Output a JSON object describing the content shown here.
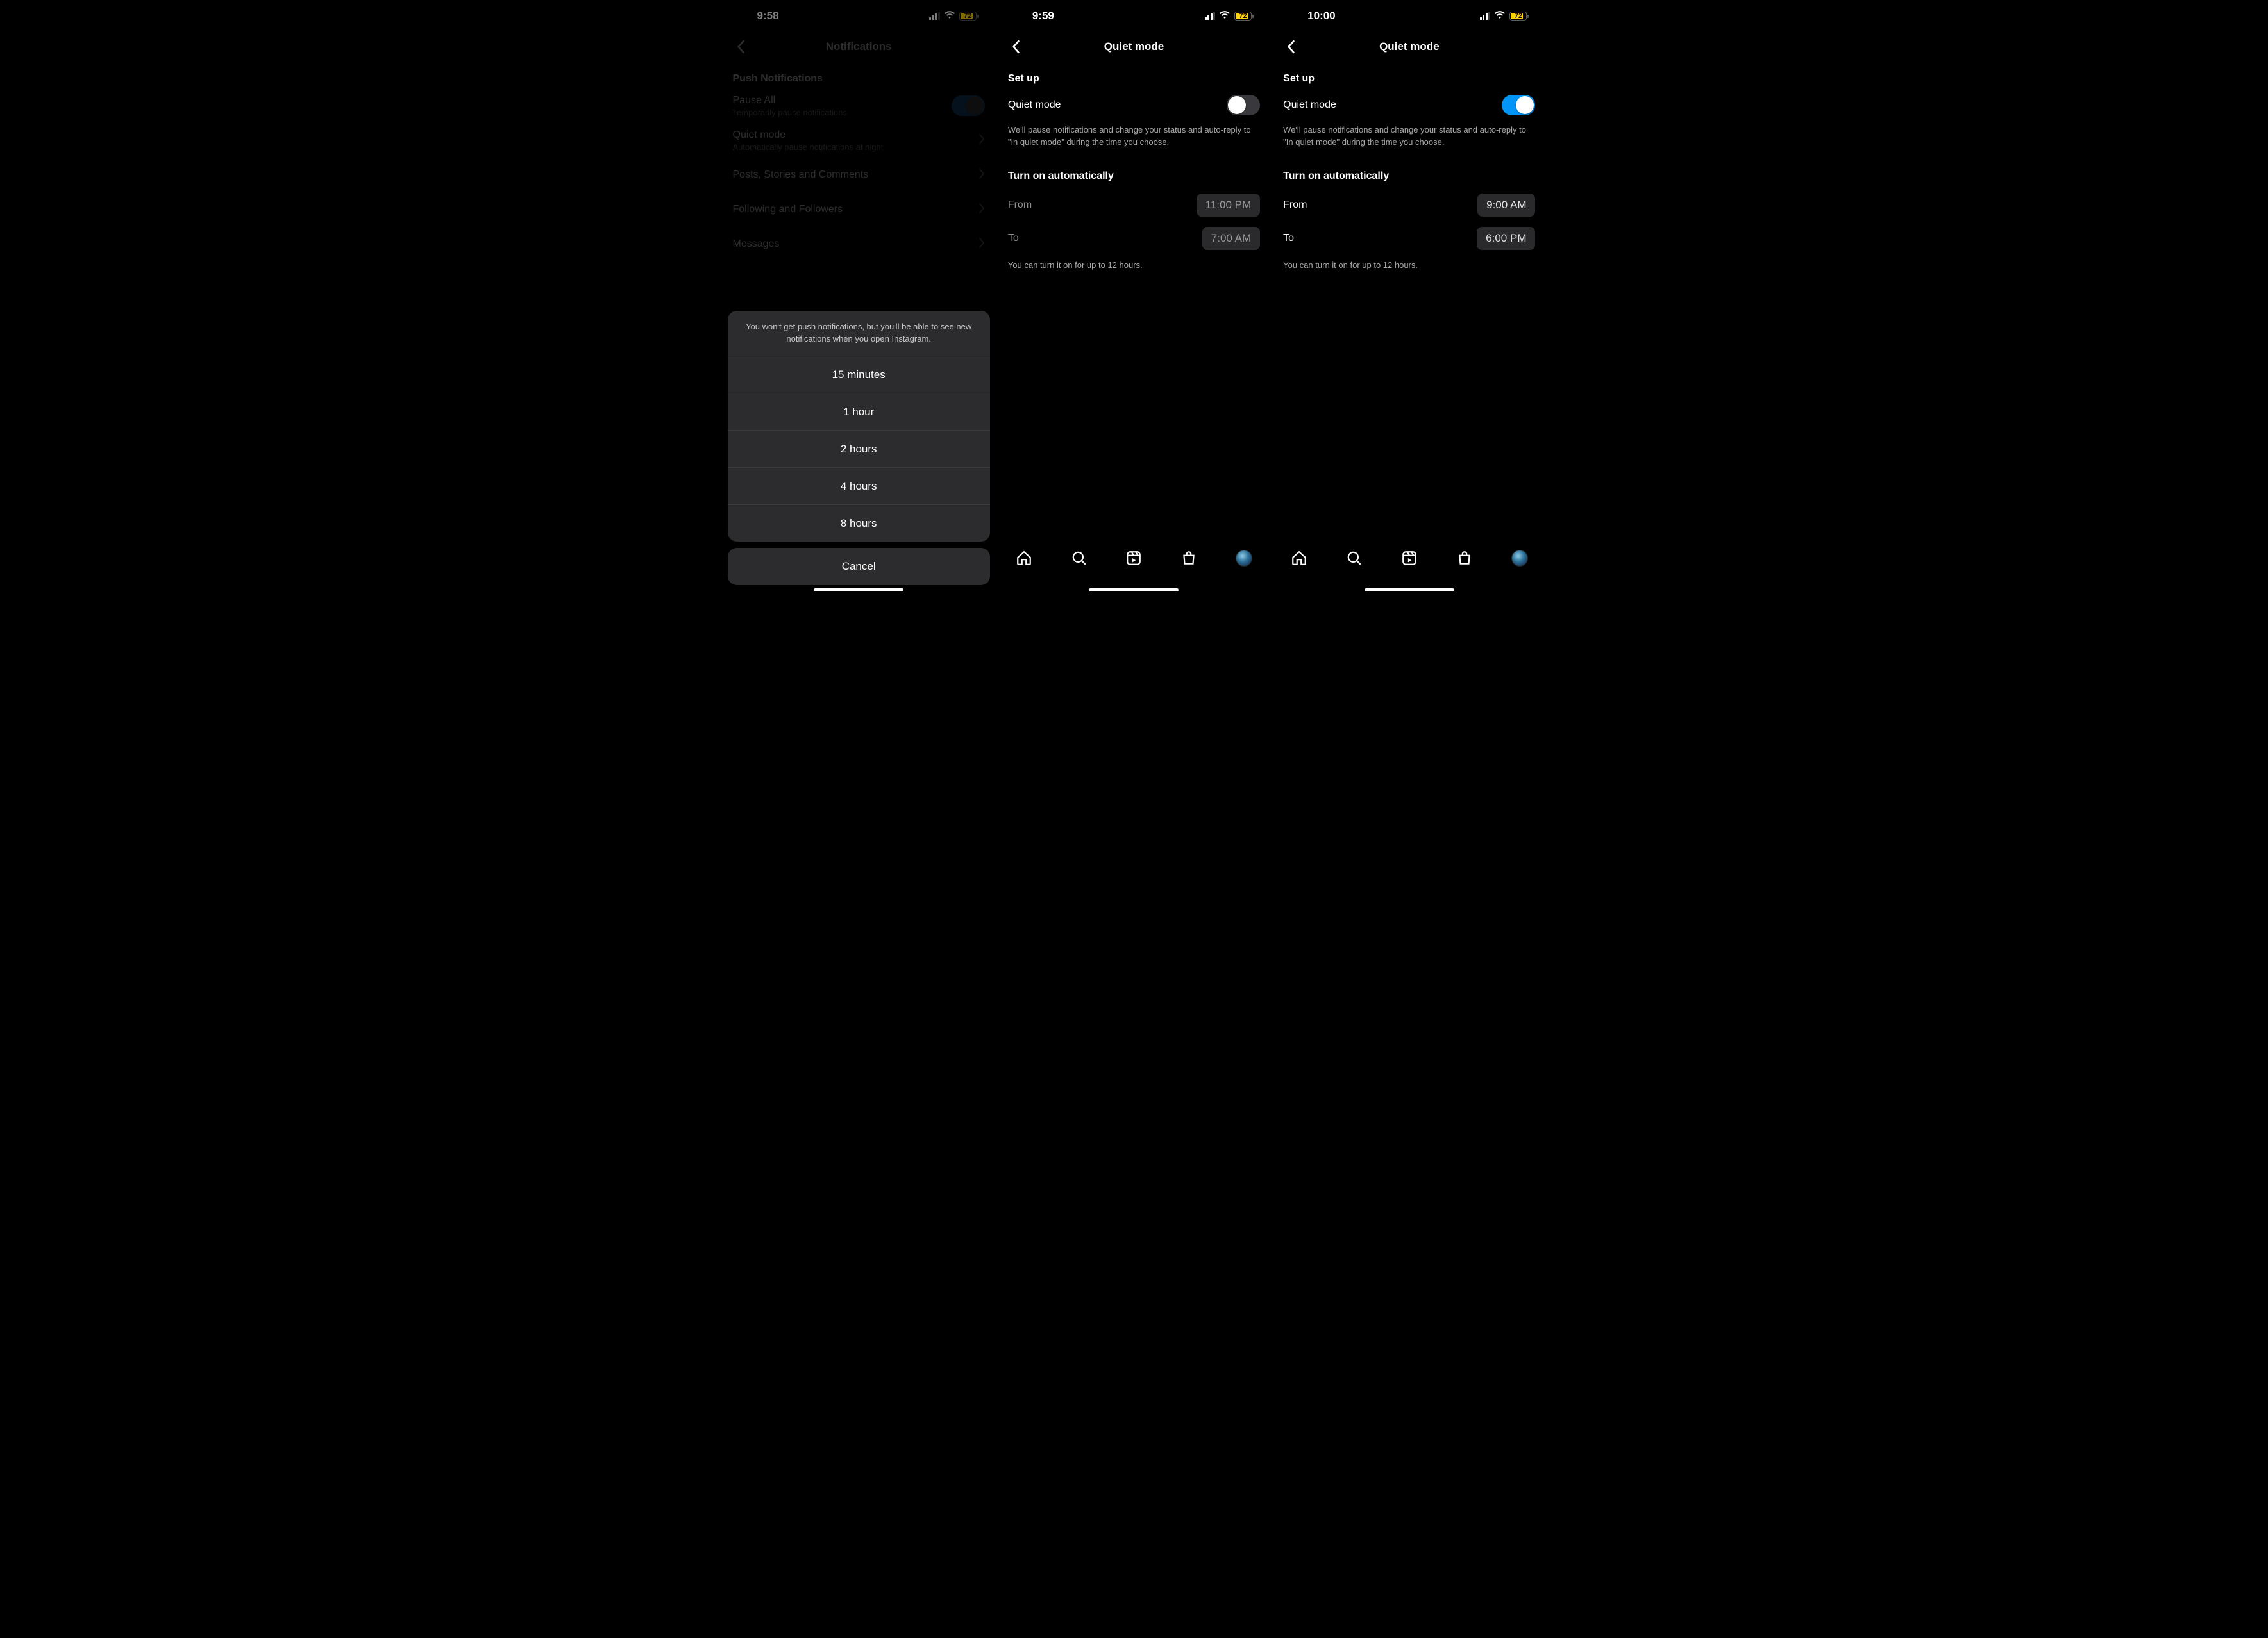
{
  "status": {
    "battery_pct": "72"
  },
  "screen1": {
    "time": "9:58",
    "title": "Notifications",
    "section": "Push Notifications",
    "pause_all": {
      "title": "Pause All",
      "subtitle": "Temporarily pause notifications"
    },
    "quiet_mode_row": {
      "title": "Quiet mode",
      "subtitle": "Automatically pause notifications at night"
    },
    "rows": {
      "posts": "Posts, Stories and Comments",
      "following": "Following and Followers",
      "messages": "Messages"
    },
    "sheet": {
      "message": "You won't get push notifications, but you'll be able to see new notifications when you open Instagram.",
      "options": [
        "15 minutes",
        "1 hour",
        "2 hours",
        "4 hours",
        "8 hours"
      ],
      "cancel": "Cancel"
    }
  },
  "screen2": {
    "time": "9:59",
    "title": "Quiet mode",
    "setup_heading": "Set up",
    "toggle_label": "Quiet mode",
    "desc": "We'll pause notifications and change your status and auto-reply to \"In quiet mode\" during the time you choose.",
    "auto_heading": "Turn on automatically",
    "from_label": "From",
    "from_value": "11:00 PM",
    "to_label": "To",
    "to_value": "7:00 AM",
    "hint": "You can turn it on for up to 12 hours."
  },
  "screen3": {
    "time": "10:00",
    "title": "Quiet mode",
    "setup_heading": "Set up",
    "toggle_label": "Quiet mode",
    "desc": "We'll pause notifications and change your status and auto-reply to \"In quiet mode\" during the time you choose.",
    "auto_heading": "Turn on automatically",
    "from_label": "From",
    "from_value": "9:00 AM",
    "to_label": "To",
    "to_value": "6:00 PM",
    "hint": "You can turn it on for up to 12 hours."
  }
}
